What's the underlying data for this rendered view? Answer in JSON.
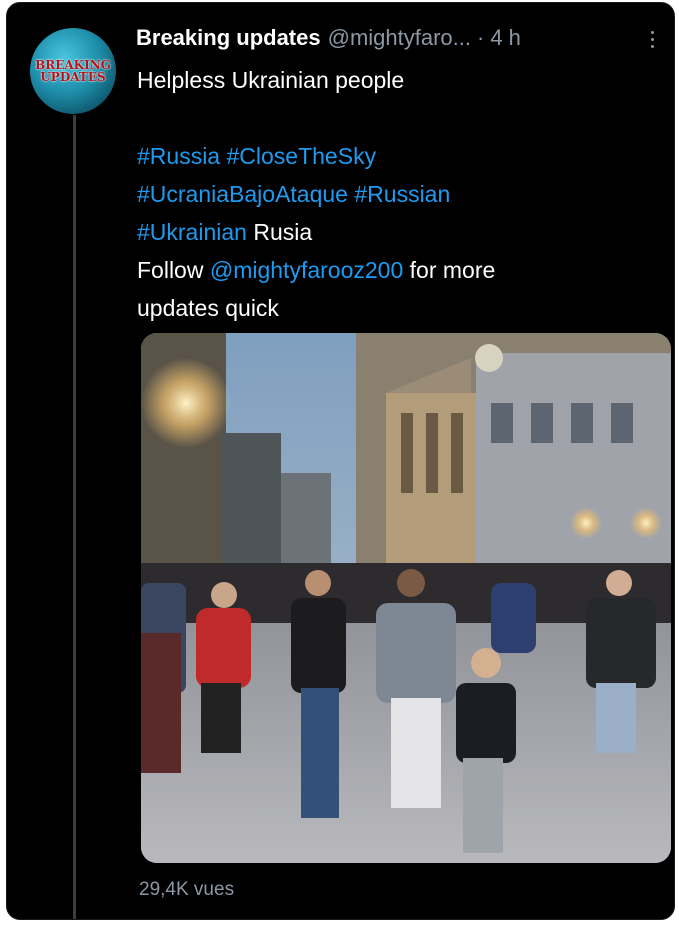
{
  "avatar": {
    "line1": "BREAKING",
    "line2": "UPDATES",
    "background": "#1f8fab",
    "text_color": "#b3121a"
  },
  "tweet": {
    "display_name": "Breaking updates",
    "handle": "@mightyfaro...",
    "separator": "·",
    "time": "4 h",
    "text": {
      "line1": "Helpless Ukrainian people",
      "hashtags_line1": [
        "#Russia",
        "#CloseTheSky"
      ],
      "hashtags_line2": [
        "#UcraniaBajoAtaque",
        "#Russian"
      ],
      "hashtag_line3": "#Ukrainian",
      "line3_suffix": " Rusia",
      "follow_prefix": "Follow ",
      "mention": "@mightyfarooz200",
      "follow_suffix": " for more",
      "last_line": "updates quick"
    },
    "views": "29,4K vues"
  },
  "colors": {
    "background": "#000000",
    "text": "#ffffff",
    "muted": "#8b98a5",
    "link": "#1d9bf0"
  }
}
